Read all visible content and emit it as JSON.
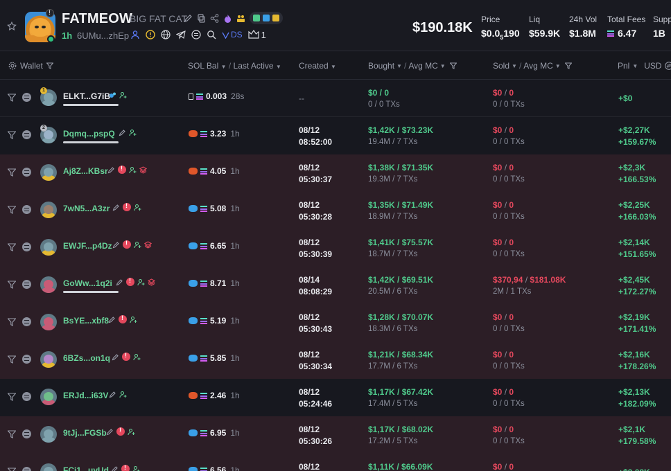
{
  "token": {
    "symbol": "FATMEOW",
    "name": "BIG FAT CAT",
    "age": "1h",
    "address": "6UMu...zhEp",
    "ds_label": "DS",
    "holders_count": "1"
  },
  "stats": {
    "market_cap": "$190.18K",
    "price_label": "Price",
    "price_value": "$0.0",
    "price_zeros": "5",
    "price_digits": "190",
    "liq_label": "Liq",
    "liq_value": "$59.9K",
    "vol_label": "24h Vol",
    "vol_value": "$1.8M",
    "fees_label": "Total Fees",
    "fees_value": "6.47",
    "supply_label": "Supp",
    "supply_value": "1B"
  },
  "columns": {
    "wallet": "Wallet",
    "sol_bal": "SOL Bal",
    "last_active": "Last Active",
    "created": "Created",
    "bought": "Bought",
    "bought_avg": "Avg MC",
    "sold": "Sold",
    "sold_avg": "Avg MC",
    "pnl": "Pnl",
    "currency": "USD"
  },
  "rows": [
    {
      "wallet": "ELKT...G7iB",
      "rank": "1",
      "sol": "0.003",
      "ago": "28s",
      "created_date": "",
      "created_time": "",
      "created_dash": "--",
      "bought_top": "$0 / 0",
      "bought_bot": "0 / 0 TXs",
      "sold_top": "$0",
      "sold_mc": "0",
      "sold_bot": "0 / 0 TXs",
      "pnl_usd": "+$0",
      "pnl_pct": ""
    },
    {
      "wallet": "Dqmq...pspQ",
      "rank": "2",
      "sol": "3.23",
      "ago": "1h",
      "created_date": "08/12",
      "created_time": "08:52:00",
      "created_dash": "",
      "bought_top": "$1,42K / $73.23K",
      "bought_bot": "19.4M / 7 TXs",
      "sold_top": "$0",
      "sold_mc": "0",
      "sold_bot": "0 / 0 TXs",
      "pnl_usd": "+$2,27K",
      "pnl_pct": "+159.67%"
    },
    {
      "wallet": "Aj8Z...KBsr",
      "rank": "",
      "sol": "4.05",
      "ago": "1h",
      "created_date": "08/12",
      "created_time": "05:30:37",
      "created_dash": "",
      "bought_top": "$1,38K / $71.35K",
      "bought_bot": "19.3M / 7 TXs",
      "sold_top": "$0",
      "sold_mc": "0",
      "sold_bot": "0 / 0 TXs",
      "pnl_usd": "+$2,3K",
      "pnl_pct": "+166.53%"
    },
    {
      "wallet": "7wN5...A3zr",
      "rank": "",
      "sol": "5.08",
      "ago": "1h",
      "created_date": "08/12",
      "created_time": "05:30:28",
      "created_dash": "",
      "bought_top": "$1,35K / $71.49K",
      "bought_bot": "18.9M / 7 TXs",
      "sold_top": "$0",
      "sold_mc": "0",
      "sold_bot": "0 / 0 TXs",
      "pnl_usd": "+$2,25K",
      "pnl_pct": "+166.03%"
    },
    {
      "wallet": "EWJF...p4Dz",
      "rank": "",
      "sol": "6.65",
      "ago": "1h",
      "created_date": "08/12",
      "created_time": "05:30:39",
      "created_dash": "",
      "bought_top": "$1,41K / $75.57K",
      "bought_bot": "18.7M / 7 TXs",
      "sold_top": "$0",
      "sold_mc": "0",
      "sold_bot": "0 / 0 TXs",
      "pnl_usd": "+$2,14K",
      "pnl_pct": "+151.65%"
    },
    {
      "wallet": "GoWw...1q2i",
      "rank": "",
      "sol": "8.71",
      "ago": "1h",
      "created_date": "08/14",
      "created_time": "08:08:29",
      "created_dash": "",
      "bought_top": "$1,42K / $69.51K",
      "bought_bot": "20.5M / 6 TXs",
      "sold_top": "$370,94",
      "sold_mc": "$181.08K",
      "sold_bot": "2M / 1 TXs",
      "pnl_usd": "+$2,45K",
      "pnl_pct": "+172.27%"
    },
    {
      "wallet": "BsYE...xbf8",
      "rank": "",
      "sol": "5.19",
      "ago": "1h",
      "created_date": "08/12",
      "created_time": "05:30:43",
      "created_dash": "",
      "bought_top": "$1,28K / $70.07K",
      "bought_bot": "18.3M / 6 TXs",
      "sold_top": "$0",
      "sold_mc": "0",
      "sold_bot": "0 / 0 TXs",
      "pnl_usd": "+$2,19K",
      "pnl_pct": "+171.41%"
    },
    {
      "wallet": "6BZs...on1q",
      "rank": "",
      "sol": "5.85",
      "ago": "1h",
      "created_date": "08/12",
      "created_time": "05:30:34",
      "created_dash": "",
      "bought_top": "$1,21K / $68.34K",
      "bought_bot": "17.7M / 6 TXs",
      "sold_top": "$0",
      "sold_mc": "0",
      "sold_bot": "0 / 0 TXs",
      "pnl_usd": "+$2,16K",
      "pnl_pct": "+178.26%"
    },
    {
      "wallet": "ERJd...i63V",
      "rank": "",
      "sol": "2.46",
      "ago": "1h",
      "created_date": "08/12",
      "created_time": "05:24:46",
      "created_dash": "",
      "bought_top": "$1,17K / $67.42K",
      "bought_bot": "17.4M / 5 TXs",
      "sold_top": "$0",
      "sold_mc": "0",
      "sold_bot": "0 / 0 TXs",
      "pnl_usd": "+$2,13K",
      "pnl_pct": "+182.09%"
    },
    {
      "wallet": "9tJj...FGSb",
      "rank": "",
      "sol": "6.95",
      "ago": "1h",
      "created_date": "08/12",
      "created_time": "05:30:26",
      "created_dash": "",
      "bought_top": "$1,17K / $68.02K",
      "bought_bot": "17.2M / 5 TXs",
      "sold_top": "$0",
      "sold_mc": "0",
      "sold_bot": "0 / 0 TXs",
      "pnl_usd": "+$2,1K",
      "pnl_pct": "+179.58%"
    },
    {
      "wallet": "FCi1...uyUd",
      "rank": "",
      "sol": "6.56",
      "ago": "1h",
      "created_date": "08/12",
      "created_time": "",
      "created_dash": "",
      "bought_top": "$1,11K / $66.09K",
      "bought_bot": "",
      "sold_top": "$0",
      "sold_mc": "0",
      "sold_bot": "",
      "pnl_usd": "+$2,08K",
      "pnl_pct": ""
    }
  ],
  "colors": {
    "green": "#4fc98b",
    "red": "#e5485d",
    "row_dark": "#17181f",
    "row_red": "#2c1e26",
    "accent_blue": "#5c7cfa"
  }
}
